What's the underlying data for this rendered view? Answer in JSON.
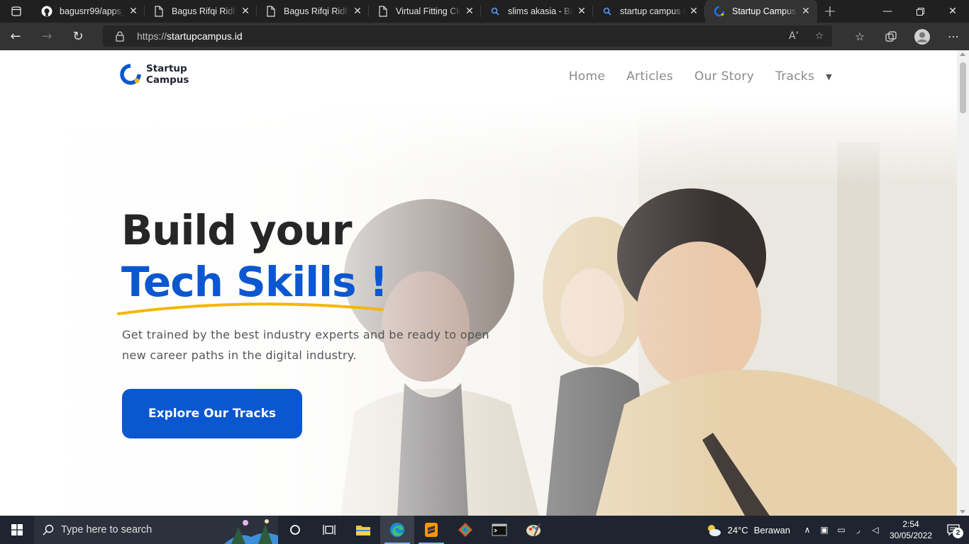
{
  "browser": {
    "tabs": [
      {
        "label": "bagusrr99/apps_c",
        "icon": "github-icon",
        "active": false
      },
      {
        "label": "Bagus Rifqi Ridho",
        "icon": "document-icon",
        "active": false
      },
      {
        "label": "Bagus Rifqi Ridho",
        "icon": "document-icon",
        "active": false
      },
      {
        "label": "Virtual Fitting Clo",
        "icon": "document-icon",
        "active": false
      },
      {
        "label": "slims akasia - Bin",
        "icon": "search-icon",
        "active": false
      },
      {
        "label": "startup campus k",
        "icon": "search-icon",
        "active": false
      },
      {
        "label": "Startup Campus -",
        "icon": "startup-campus-favicon",
        "active": true
      }
    ],
    "address": {
      "scheme": "https://",
      "host": "startupcampus.id"
    }
  },
  "site": {
    "logo": {
      "line1": "Startup",
      "line2": "Campus"
    },
    "nav": {
      "home": "Home",
      "articles": "Articles",
      "our_story": "Our Story",
      "tracks": "Tracks"
    },
    "hero": {
      "title_line1": "Build your",
      "title_line2": "Tech Skills !",
      "subtitle_line1": "Get trained by the best industry experts and be ready to open",
      "subtitle_line2": "new career paths in the digital industry.",
      "cta": "Explore Our Tracks"
    },
    "colors": {
      "brand_blue": "#0b57d0",
      "accent_yellow": "#f2b705",
      "heading_dark": "#262626"
    }
  },
  "taskbar": {
    "search_placeholder": "Type here to search",
    "weather": {
      "temp": "24°C",
      "condition": "Berawan"
    },
    "clock": {
      "time": "2:54",
      "date": "30/05/2022"
    },
    "notification_count": "2"
  }
}
